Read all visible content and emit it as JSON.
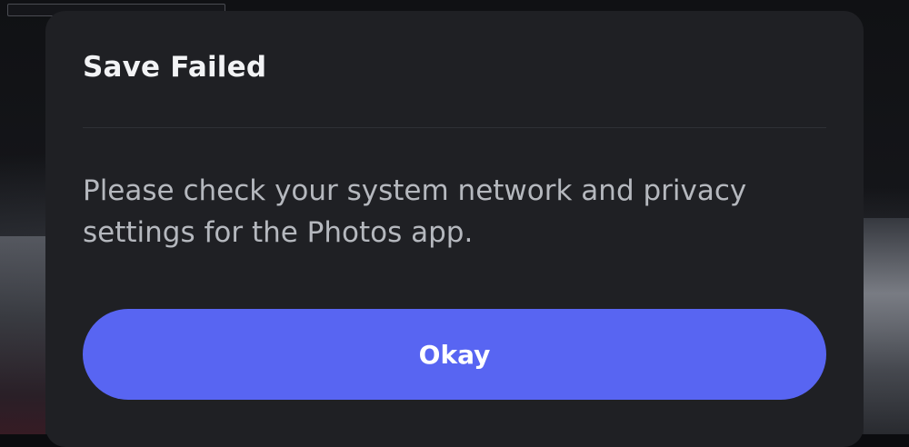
{
  "dialog": {
    "title": "Save Failed",
    "message": "Please check your system network and privacy settings for the Photos app.",
    "confirm_label": "Okay"
  },
  "colors": {
    "dialog_background": "#1f2024",
    "button_accent": "#5865f2",
    "title_text": "#f2f3f5",
    "body_text": "#b5b8be"
  }
}
